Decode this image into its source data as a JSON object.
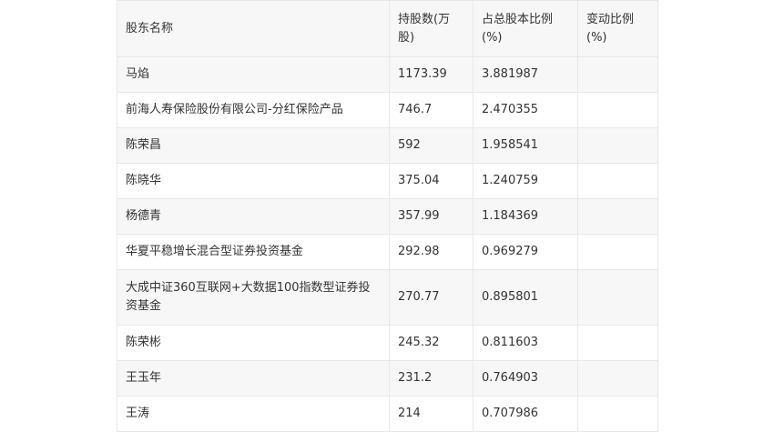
{
  "table": {
    "headers": [
      "股东名称",
      "持股数(万股)",
      "占总股本比例(%)",
      "变动比例(%)"
    ],
    "rows": [
      [
        "马焰",
        "1173.39",
        "3.881987",
        ""
      ],
      [
        "前海人寿保险股份有限公司-分红保险产品",
        "746.7",
        "2.470355",
        ""
      ],
      [
        "陈荣昌",
        "592",
        "1.958541",
        ""
      ],
      [
        "陈晓华",
        "375.04",
        "1.240759",
        ""
      ],
      [
        "杨德青",
        "357.99",
        "1.184369",
        ""
      ],
      [
        "华夏平稳增长混合型证券投资基金",
        "292.98",
        "0.969279",
        ""
      ],
      [
        "大成中证360互联网+大数据100指数型证券投资基金",
        "270.77",
        "0.895801",
        ""
      ],
      [
        "陈荣彬",
        "245.32",
        "0.811603",
        ""
      ],
      [
        "王玉年",
        "231.2",
        "0.764903",
        ""
      ],
      [
        "王涛",
        "214",
        "0.707986",
        ""
      ]
    ]
  }
}
